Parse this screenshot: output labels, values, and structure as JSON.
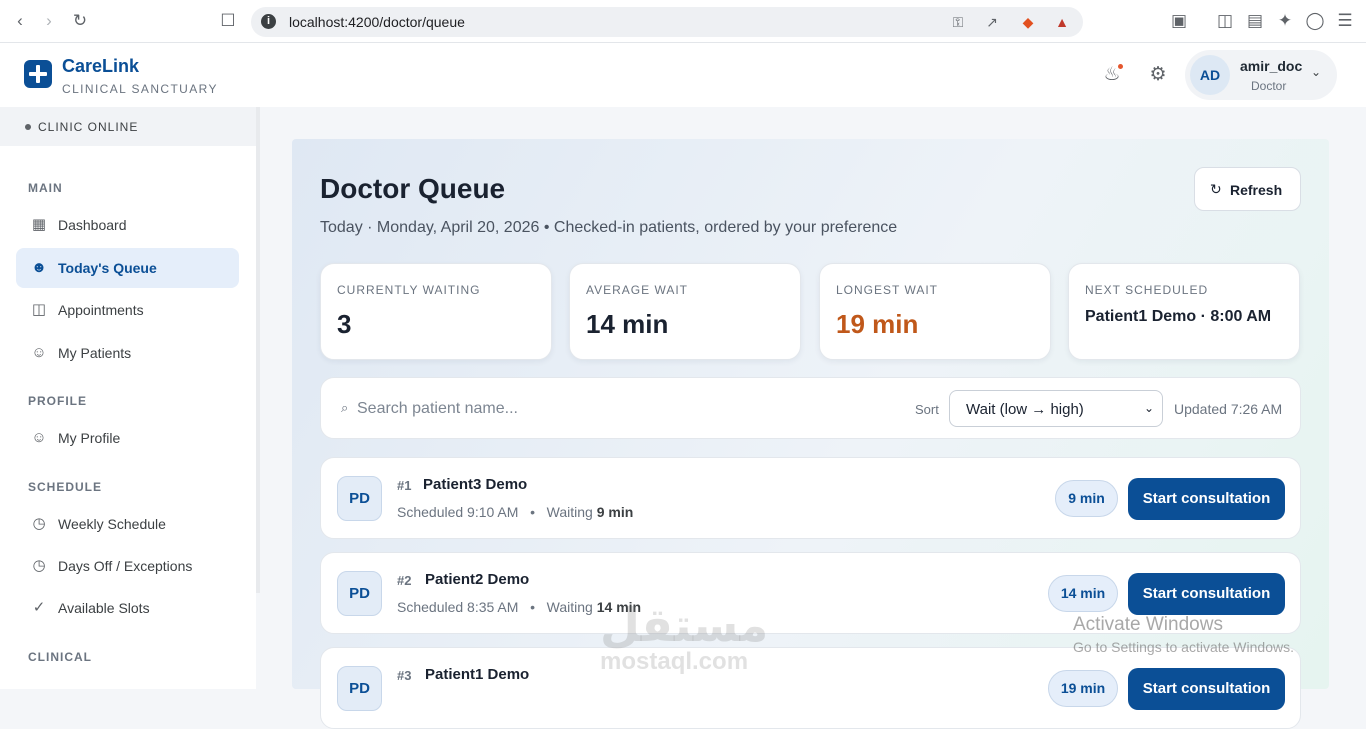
{
  "browser": {
    "url": "localhost:4200/doctor/queue"
  },
  "brand": {
    "name": "CareLink",
    "tagline": "CLINICAL SANCTUARY"
  },
  "user": {
    "initials": "AD",
    "name": "amir_doc",
    "role": "Doctor"
  },
  "sidebar": {
    "status": "CLINIC ONLINE",
    "sections": {
      "main": "MAIN",
      "profile": "PROFILE",
      "schedule": "SCHEDULE",
      "clinical": "CLINICAL"
    },
    "items": {
      "dashboard": "Dashboard",
      "queue": "Today's Queue",
      "appointments": "Appointments",
      "patients": "My Patients",
      "profile": "My Profile",
      "weekly": "Weekly Schedule",
      "daysoff": "Days Off / Exceptions",
      "slots": "Available Slots"
    }
  },
  "page": {
    "title": "Doctor Queue",
    "subtitle": "Today · Monday, April 20, 2026  • Checked-in patients, ordered by your preference",
    "refresh_label": "Refresh"
  },
  "stats": {
    "waiting": {
      "label": "CURRENTLY WAITING",
      "value": "3"
    },
    "average": {
      "label": "AVERAGE WAIT",
      "value": "14 min"
    },
    "longest": {
      "label": "LONGEST WAIT",
      "value": "19 min"
    },
    "next": {
      "label": "NEXT SCHEDULED",
      "value": "Patient1 Demo · 8:00 AM"
    }
  },
  "toolbar": {
    "search_placeholder": "Search patient name...",
    "sort_label": "Sort",
    "sort_value": "Wait (low → high)",
    "updated": "Updated 7:26 AM"
  },
  "queue": [
    {
      "initials": "PD",
      "num": "#1",
      "name": "Patient3 Demo",
      "scheduled": "Scheduled 9:10 AM",
      "waiting_label": "Waiting",
      "waiting_value": "9 min",
      "pill": "9 min",
      "action": "Start consultation"
    },
    {
      "initials": "PD",
      "num": "#2",
      "name": "Patient2 Demo",
      "scheduled": "Scheduled 8:35 AM",
      "waiting_label": "Waiting",
      "waiting_value": "14 min",
      "pill": "14 min",
      "action": "Start consultation"
    },
    {
      "initials": "PD",
      "num": "#3",
      "name": "Patient1 Demo",
      "scheduled": "",
      "waiting_label": "",
      "waiting_value": "",
      "pill": "19 min",
      "action": "Start consultation"
    }
  ],
  "watermarks": {
    "mostaql_ar": "مستقل",
    "mostaql_en": "mostaql.com",
    "activate_title": "Activate Windows",
    "activate_sub": "Go to Settings to activate Windows."
  }
}
